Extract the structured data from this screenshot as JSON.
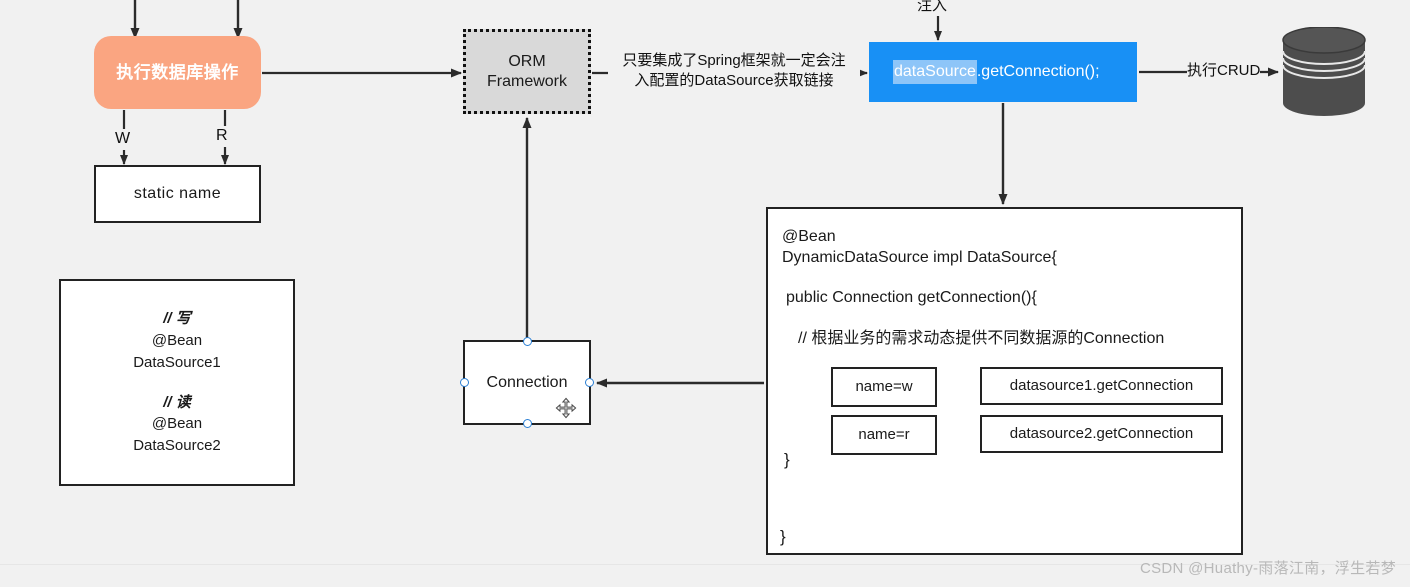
{
  "diagram": {
    "title": "Dynamic DataSource routing diagram",
    "background_color": "#f1f1f1"
  },
  "nodes": {
    "op_node": {
      "label": "执行数据库操作",
      "color": "#faa581",
      "text_color": "#ffffff"
    },
    "static_box": {
      "label": "static  name"
    },
    "bean_box": {
      "lines": [
        "// 写",
        "@Bean",
        "DataSource1",
        "// 读",
        "@Bean",
        "DataSource2"
      ],
      "write_comment": "// 写",
      "write_bean": "@Bean",
      "write_name": "DataSource1",
      "read_comment": "// 读",
      "read_bean": "@Bean",
      "read_name": "DataSource2"
    },
    "orm_box": {
      "line1": "ORM",
      "line2": "Framework",
      "color": "#d9d9d9"
    },
    "connection_box": {
      "label": "Connection",
      "selected": "true"
    },
    "blue_box": {
      "selected_text": "dataSource",
      "rest_text": ".getConnection();",
      "color": "#1890f5",
      "selection_color": "#8dc5f8"
    },
    "database": {
      "label": "database-cylinder",
      "color": "#4d4d4d"
    }
  },
  "code_box": {
    "line_bean": "@Bean",
    "line_class": "DynamicDataSource impl  DataSource{",
    "line_method": "public Connection getConnection(){",
    "line_comment": "//  根据业务的需求动态提供不同数据源的Connection",
    "brace_inner": "}",
    "brace_outer": "}",
    "branches": [
      {
        "condition": "name=w",
        "result": "datasource1.getConnection"
      },
      {
        "condition": "name=r",
        "result": "datasource2.getConnection"
      }
    ]
  },
  "edge_labels": {
    "spring_inject": "只要集成了Spring框架就一定会注\n入配置的DataSource获取链接",
    "execute_crud": "执行CRUD",
    "inject": "注入",
    "write": "W",
    "read": "R"
  },
  "watermark": {
    "text": "CSDN @Huathy-雨落江南，浮生若梦",
    "color": "#b8b8b8"
  }
}
